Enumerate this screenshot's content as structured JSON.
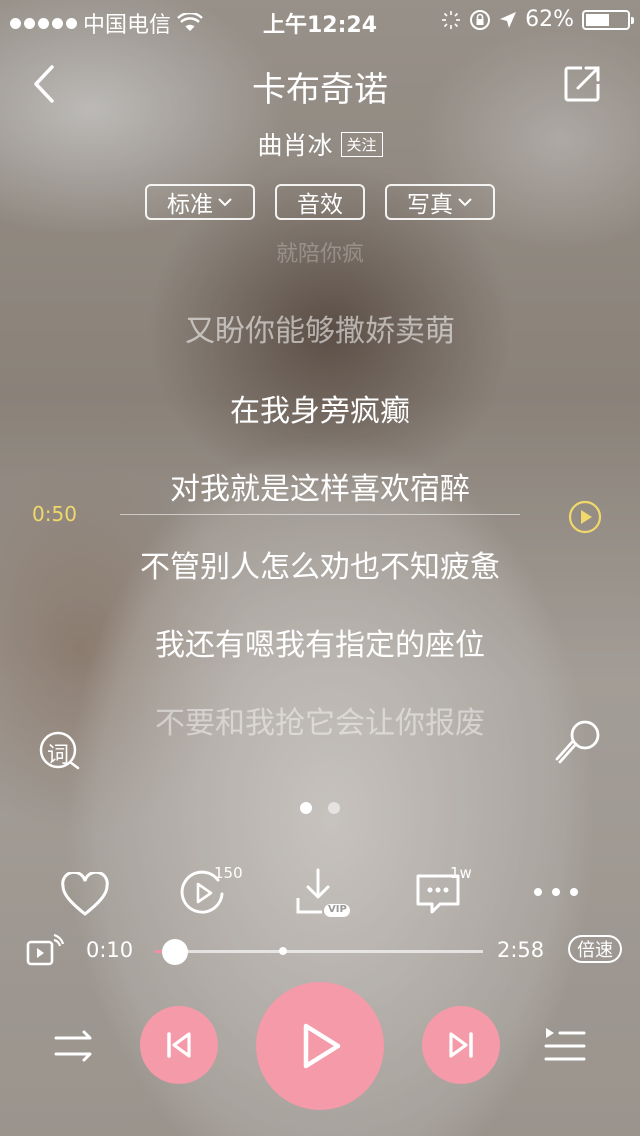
{
  "status_bar": {
    "carrier": "中国电信",
    "time": "上午12:24",
    "battery": "62%",
    "battery_level": 0.62
  },
  "header": {
    "title": "卡布奇诺"
  },
  "artist": {
    "name": "曲肖冰",
    "follow_label": "关注"
  },
  "pills": {
    "quality": "标准",
    "effects": "音效",
    "photo": "写真"
  },
  "lyrics": {
    "faded_top": "就陪你疯",
    "lines": [
      "又盼你能够撒娇卖萌",
      "在我身旁疯癫",
      "对我就是这样喜欢宿醉",
      "不管别人怎么劝也不知疲惫",
      "我还有嗯我有指定的座位",
      "不要和我抢它会让你报废"
    ],
    "marker_time": "0:50",
    "lyric_button": "词"
  },
  "actions": {
    "play_count": "150",
    "comment_count": "1w",
    "download_badge": "VIP"
  },
  "progress": {
    "current": "0:10",
    "total": "2:58",
    "position": 0.06,
    "speed_label": "倍速"
  },
  "colors": {
    "accent": "#f49aa9",
    "lyric_marker": "#f0d96a"
  }
}
